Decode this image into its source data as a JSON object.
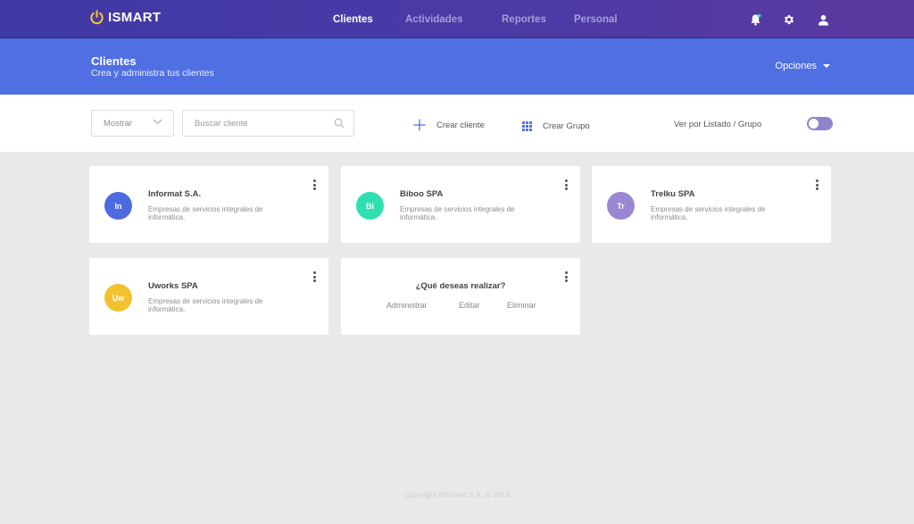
{
  "app": {
    "logo_text": "ISMART"
  },
  "nav": {
    "items": [
      "Clientes",
      "Actividades",
      "Reportes",
      "Personal"
    ],
    "active": 0
  },
  "header_icons": [
    "bell-icon",
    "gear-icon",
    "user-icon"
  ],
  "banner": {
    "title": "Clientes",
    "subtitle": "Crea y administra tus clientes",
    "options_label": "Opciones"
  },
  "toolbar": {
    "show_label": "Mostrar",
    "search_placeholder": "Buscar cliente",
    "create_client": "Crear cliente",
    "create_group": "Crear Grupo",
    "view_by": "Ver por  Listado / Grupo"
  },
  "clients": [
    {
      "initials": "In",
      "name": "Informat S.A.",
      "description": "Empresas de servicios integrales de informática.",
      "color": "#4e6ae0"
    },
    {
      "initials": "Bi",
      "name": "Biboo SPA",
      "description": "Empresas de servicios integrales de informática.",
      "color": "#2ee0b0"
    },
    {
      "initials": "Tr",
      "name": "Trelku SPA",
      "description": "Empresas de servicios integrales de informática.",
      "color": "#9a86d3"
    },
    {
      "initials": "Uw",
      "name": "Uworks SPA",
      "description": "Empresas de servicios integrales de informática.",
      "color": "#f3c12e"
    }
  ],
  "action_card": {
    "title": "¿Qué deseas realizar?",
    "actions": [
      "Administrar",
      "Editar",
      "Eliminar"
    ]
  },
  "footer": {
    "copyright": "Copyright Informat S.A. © 2018"
  },
  "colors": {
    "topbar": "#4a3aa6",
    "banner": "#4f6fe3",
    "accent": "#4e6ae0",
    "toggle": "#8f83c9"
  }
}
